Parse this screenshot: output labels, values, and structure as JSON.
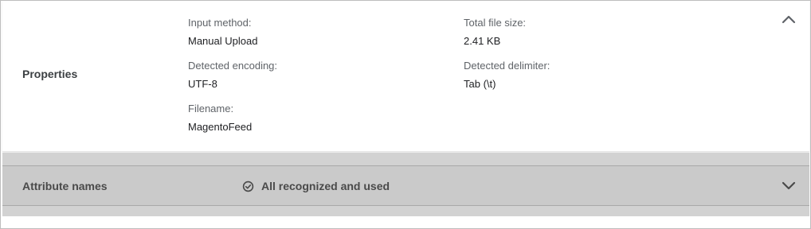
{
  "properties": {
    "title": "Properties",
    "input_method": {
      "label": "Input method:",
      "value": "Manual Upload"
    },
    "total_file_size": {
      "label": "Total file size:",
      "value": "2.41 KB"
    },
    "detected_encoding": {
      "label": "Detected encoding:",
      "value": "UTF-8"
    },
    "detected_delimiter": {
      "label": "Detected delimiter:",
      "value": "Tab (\\t)"
    },
    "filename": {
      "label": "Filename:",
      "value": "MagentoFeed"
    },
    "collapse_icon": "chevron-up-icon"
  },
  "attribute_names": {
    "title": "Attribute names",
    "status_icon": "check-circle-icon",
    "status_text": "All recognized and used",
    "expand_icon": "chevron-down-icon"
  },
  "colors": {
    "selected_panel_bg": "#cacaca",
    "label_gray": "#5f6368",
    "value_dark": "#202124"
  }
}
